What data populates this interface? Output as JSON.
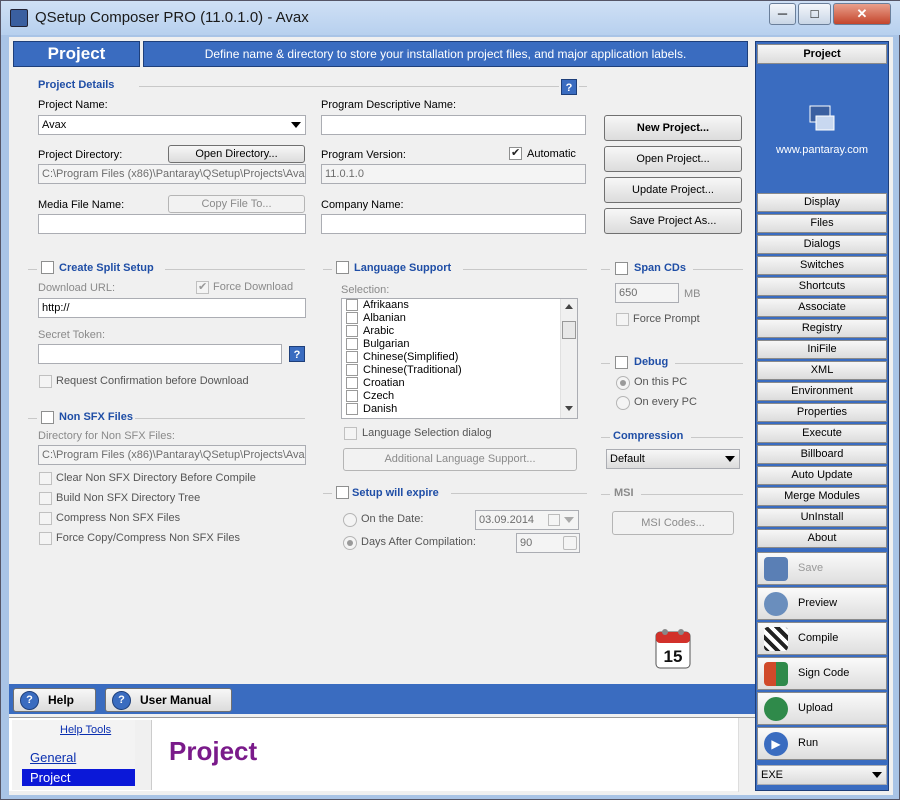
{
  "window": {
    "title": "QSetup Composer PRO (11.0.1.0) - Avax",
    "min": "─",
    "max": "□",
    "close": "✕"
  },
  "header": {
    "title": "Project",
    "description": "Define name & directory to store your installation project files, and major application labels."
  },
  "project_details": {
    "heading": "Project Details",
    "help": "?",
    "project_name_label": "Project Name:",
    "project_name_value": "Avax",
    "descriptive_name_label": "Program Descriptive Name:",
    "descriptive_name_value": "",
    "project_dir_label": "Project Directory:",
    "open_directory_button": "Open Directory...",
    "project_dir_value": "C:\\Program Files (x86)\\Pantaray\\QSetup\\Projects\\Avax",
    "version_label": "Program Version:",
    "automatic_label": "Automatic",
    "automatic_checked": true,
    "version_value": "11.0.1.0",
    "media_label": "Media File Name:",
    "copy_file_button": "Copy File To...",
    "media_value": "",
    "company_label": "Company Name:",
    "company_value": ""
  },
  "project_buttons": {
    "new": "New Project...",
    "open": "Open Project...",
    "update": "Update Project...",
    "save_as": "Save Project As..."
  },
  "split_setup": {
    "heading": "Create Split Setup",
    "download_url_label": "Download URL:",
    "force_download_label": "Force Download",
    "url_value": "http://",
    "secret_token_label": "Secret Token:",
    "token_value": "",
    "help": "?",
    "request_confirmation": "Request Confirmation before Download"
  },
  "non_sfx": {
    "heading": "Non SFX Files",
    "dir_label": "Directory for Non SFX Files:",
    "dir_value": "C:\\Program Files (x86)\\Pantaray\\QSetup\\Projects\\Avax",
    "options": [
      "Clear Non SFX Directory Before Compile",
      "Build Non SFX Directory Tree",
      "Compress Non SFX Files",
      "Force Copy/Compress Non SFX Files"
    ]
  },
  "language": {
    "heading": "Language Support",
    "selection_label": "Selection:",
    "items": [
      "Afrikaans",
      "Albanian",
      "Arabic",
      "Bulgarian",
      "Chinese(Simplified)",
      "Chinese(Traditional)",
      "Croatian",
      "Czech",
      "Danish"
    ],
    "selection_dialog": "Language Selection dialog",
    "additional_button": "Additional Language Support..."
  },
  "expire": {
    "heading": "Setup will expire",
    "on_date_label": "On the Date:",
    "date_value": "03.09.2014",
    "days_label": "Days After Compilation:",
    "days_value": "90"
  },
  "span_cds": {
    "heading": "Span CDs",
    "size_value": "650",
    "unit": "MB",
    "force_prompt": "Force Prompt"
  },
  "debug": {
    "heading": "Debug",
    "on_this_pc": "On this PC",
    "on_every_pc": "On every PC"
  },
  "compression": {
    "heading": "Compression",
    "value": "Default"
  },
  "msi": {
    "heading": "MSI",
    "button": "MSI Codes..."
  },
  "right_panel": {
    "head": "Project",
    "url": "www.pantaray.com",
    "nav": [
      "Display",
      "Files",
      "Dialogs",
      "Switches",
      "Shortcuts",
      "Associate",
      "Registry",
      "IniFile",
      "XML",
      "Environment",
      "Properties",
      "Execute",
      "Billboard",
      "Auto Update",
      "Merge Modules",
      "UnInstall",
      "About"
    ],
    "actions": [
      {
        "label": "Save",
        "icon": "save-icon",
        "color": "#5a7fb5"
      },
      {
        "label": "Preview",
        "icon": "magnifier-icon",
        "color": "#6a8ebd"
      },
      {
        "label": "Compile",
        "icon": "checkered-flag-icon",
        "color": "#333333"
      },
      {
        "label": "Sign Code",
        "icon": "shield-icon",
        "color": "#d04a2a"
      },
      {
        "label": "Upload",
        "icon": "globe-upload-icon",
        "color": "#2f8a4a"
      },
      {
        "label": "Run",
        "icon": "play-icon",
        "color": "#3a6cc0"
      }
    ],
    "output_type": "EXE"
  },
  "calendar": {
    "day": "15"
  },
  "bottom": {
    "help_button": "Help",
    "manual_button": "User Manual",
    "help_tools_link": "Help Tools",
    "tools": [
      "General",
      "Project"
    ],
    "selected_tool": "Project",
    "help_title": "Project"
  }
}
